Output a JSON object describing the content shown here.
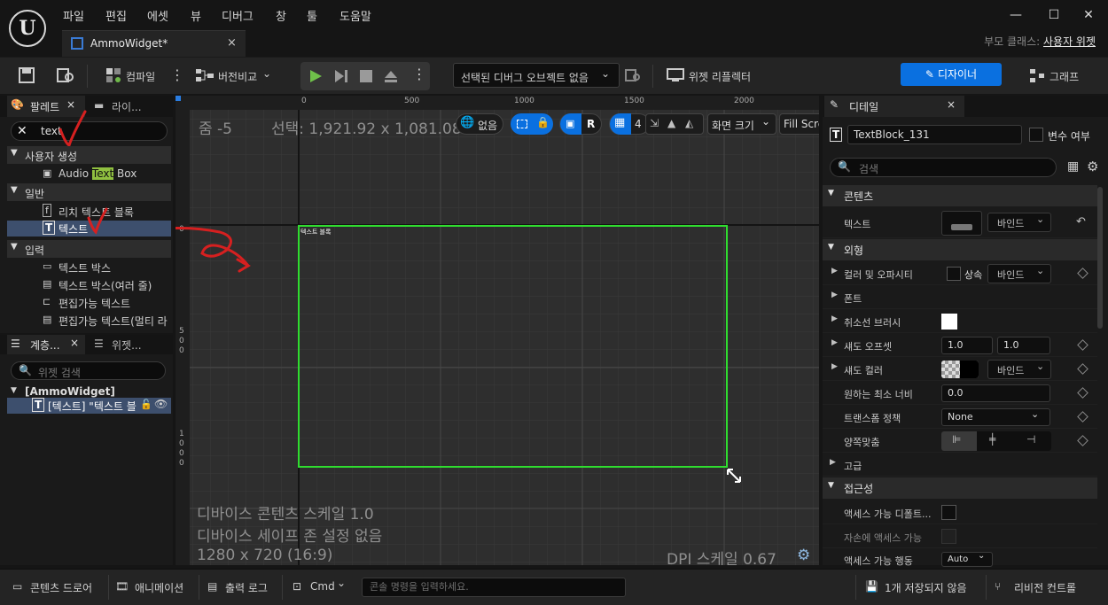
{
  "menu": [
    "파일",
    "편집",
    "에셋",
    "뷰",
    "디버그",
    "창",
    "툴",
    "도움말"
  ],
  "tab": {
    "title": "AmmoWidget*",
    "close": "×"
  },
  "window": {
    "minimize": "—",
    "maximize": "☐",
    "close": "✕"
  },
  "parent_class": {
    "label": "부모 클래스:",
    "value": "사용자 위젯"
  },
  "toolbar": {
    "compile": "컴파일",
    "diff": "버전비교",
    "debug_object": "선택된 디버그 오브젝트 없음",
    "reflector": "위젯 리플렉터",
    "designer": "디자이너",
    "graph": "그래프"
  },
  "palette": {
    "tab": "팔레트",
    "tab2": "라이...",
    "search_value": "text",
    "categories": {
      "user": "사용자 생성",
      "common": "일반",
      "input": "입력"
    },
    "user_item": {
      "prefix": "Audio ",
      "match": "Text",
      "suffix": " Box"
    },
    "common_items": [
      "리치 텍스트 블록",
      "텍스트"
    ],
    "input_items": [
      "텍스트 박스",
      "텍스트 박스(여러 줄)",
      "편집가능 텍스트",
      "편집가능 텍스트(멀티 라"
    ]
  },
  "hierarchy": {
    "tab": "계층...",
    "tab2": "위젯...",
    "search_placeholder": "위젯 검색",
    "root": "[AmmoWidget]",
    "child": "[텍스트] \"텍스트 블"
  },
  "viewport": {
    "zoom": "줌 -5",
    "selection": "선택: 1,921.92 x 1,081.08",
    "none": "없음",
    "r": "R",
    "grid_num": "4",
    "screen_size": "화면 크기",
    "fill": "Fill Scre",
    "ruler_h": [
      "0",
      "500",
      "1000",
      "1500",
      "2000"
    ],
    "ruler_v": [
      [
        "0"
      ],
      [
        "5",
        "0",
        "0"
      ],
      [
        "1",
        "0",
        "0",
        "0"
      ]
    ],
    "widget_label": "텍스트 블록",
    "device_scale": "디바이스 콘텐츠 스케일 1.0",
    "safe_zone": "디바이스 세이프 존 설정 없음",
    "resolution": "1280 x 720 (16:9)",
    "dpi": "DPI 스케일 0.67"
  },
  "details": {
    "tab": "디테일",
    "widget_name": "TextBlock_131",
    "is_variable": "변수 여부",
    "search_placeholder": "검색",
    "sections": {
      "content": "콘텐츠",
      "appearance": "외형",
      "accessibility": "접근성"
    },
    "rows": {
      "text": "텍스트",
      "bind": "바인드",
      "color": "컬러 및 오파시티",
      "inherit": "상속",
      "font": "폰트",
      "strike": "취소선 브러시",
      "shadow_offset": "섀도 오프셋",
      "shadow_offset_x": "1.0",
      "shadow_offset_y": "1.0",
      "shadow_color": "섀도 컬러",
      "min_width": "원하는 최소 너비",
      "min_width_val": "0.0",
      "transform": "트랜스폼 정책",
      "transform_val": "None",
      "justify": "양쪽맞춤",
      "advanced": "고급",
      "acc_default": "액세스 가능 디폴트...",
      "acc_children": "자손에 액세스 가능",
      "acc_behavior": "액세스 가능 행동",
      "acc_val": "Auto"
    }
  },
  "statusbar": {
    "content_drawer": "콘텐츠 드로어",
    "animation": "애니메이션",
    "output_log": "출력 로그",
    "cmd": "Cmd",
    "cmd_placeholder": "콘솔 명령을 입력하세요.",
    "unsaved": "1개 저장되지 않음",
    "revision": "리비전 컨트롤"
  }
}
